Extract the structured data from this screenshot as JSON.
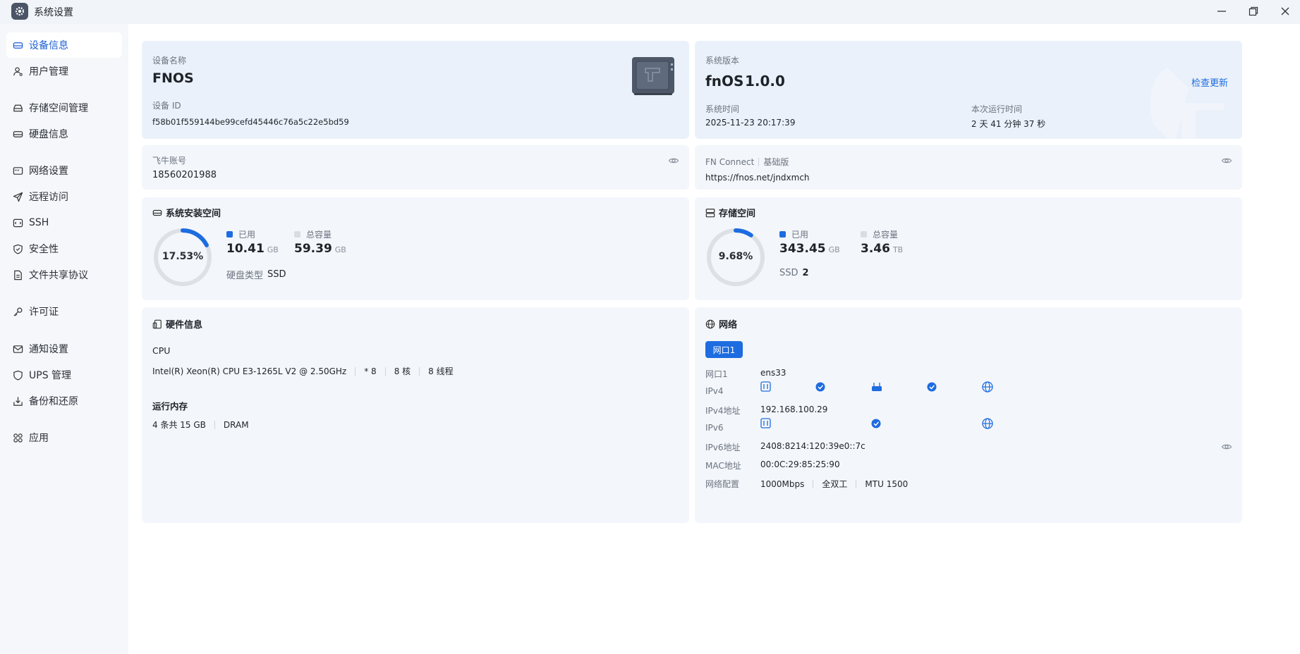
{
  "window": {
    "title": "系统设置",
    "icon": "gear-icon"
  },
  "sidebar": {
    "items": [
      {
        "label": "设备信息",
        "icon": "drive-icon",
        "active": true
      },
      {
        "label": "用户管理",
        "icon": "user-icon"
      },
      {
        "label": "存储空间管理",
        "icon": "storage-icon"
      },
      {
        "label": "硬盘信息",
        "icon": "disk-icon"
      },
      {
        "label": "网络设置",
        "icon": "network-icon"
      },
      {
        "label": "远程访问",
        "icon": "send-icon"
      },
      {
        "label": "SSH",
        "icon": "terminal-icon"
      },
      {
        "label": "安全性",
        "icon": "shield-icon"
      },
      {
        "label": "文件共享协议",
        "icon": "file-icon"
      },
      {
        "label": "许可证",
        "icon": "key-icon"
      },
      {
        "label": "通知设置",
        "icon": "mail-icon"
      },
      {
        "label": "UPS 管理",
        "icon": "ups-icon"
      },
      {
        "label": "备份和还原",
        "icon": "backup-icon"
      },
      {
        "label": "应用",
        "icon": "apps-icon"
      }
    ]
  },
  "device": {
    "name_label": "设备名称",
    "name": "FNOS",
    "id_label": "设备 ID",
    "id": "f58b01f559144be99cefd45446c76a5c22e5bd59"
  },
  "system": {
    "version_label": "系统版本",
    "os_name": "fnOS",
    "version": "1.0.0",
    "check_update": "检查更新",
    "time_label": "系统时间",
    "time": "2025-11-23 20:17:39",
    "uptime_label": "本次运行时间",
    "uptime": "2 天 41 分钟 37 秒"
  },
  "account": {
    "label": "飞牛账号",
    "value": "18560201988"
  },
  "fn_connect": {
    "label": "FN Connect",
    "tier": "基础版",
    "url": "https://fnos.net/jndxmch"
  },
  "system_space": {
    "title": "系统安装空间",
    "percent_text": "17.53%",
    "percent": 17.53,
    "used_label": "已用",
    "used_value": "10.41",
    "used_unit": "GB",
    "total_label": "总容量",
    "total_value": "59.39",
    "total_unit": "GB",
    "disk_type_label": "硬盘类型",
    "disk_type": "SSD"
  },
  "storage_space": {
    "title": "存储空间",
    "percent_text": "9.68%",
    "percent": 9.68,
    "used_label": "已用",
    "used_value": "343.45",
    "used_unit": "GB",
    "total_label": "总容量",
    "total_value": "3.46",
    "total_unit": "TB",
    "ssd_label": "SSD",
    "ssd_count": "2"
  },
  "hardware": {
    "title": "硬件信息",
    "cpu_label": "CPU",
    "cpu_model": "Intel(R) Xeon(R) CPU E3-1265L V2 @ 2.50GHz",
    "cpu_count": "* 8",
    "cores": "8 核",
    "threads": "8 线程",
    "memory_label": "运行内存",
    "memory": "4 条共 15 GB",
    "memory_type": "DRAM"
  },
  "network": {
    "title": "网络",
    "port_button": "网口1",
    "port_label": "网口1",
    "port_value": "ens33",
    "ipv4_label": "IPv4",
    "ipv4_addr_label": "IPv4地址",
    "ipv4_addr": "192.168.100.29",
    "ipv6_label": "IPv6",
    "ipv6_addr_label": "IPv6地址",
    "ipv6_addr": "2408:8214:120:39e0::7c",
    "mac_label": "MAC地址",
    "mac": "00:0C:29:85:25:90",
    "config_label": "网络配置",
    "speed": "1000Mbps",
    "duplex": "全双工",
    "mtu": "MTU 1500"
  },
  "colors": {
    "accent": "#1d6ce0",
    "ring_track": "#dde1e6",
    "card_bg": "#f3f6fa",
    "card_blue": "#eaf1fa"
  }
}
